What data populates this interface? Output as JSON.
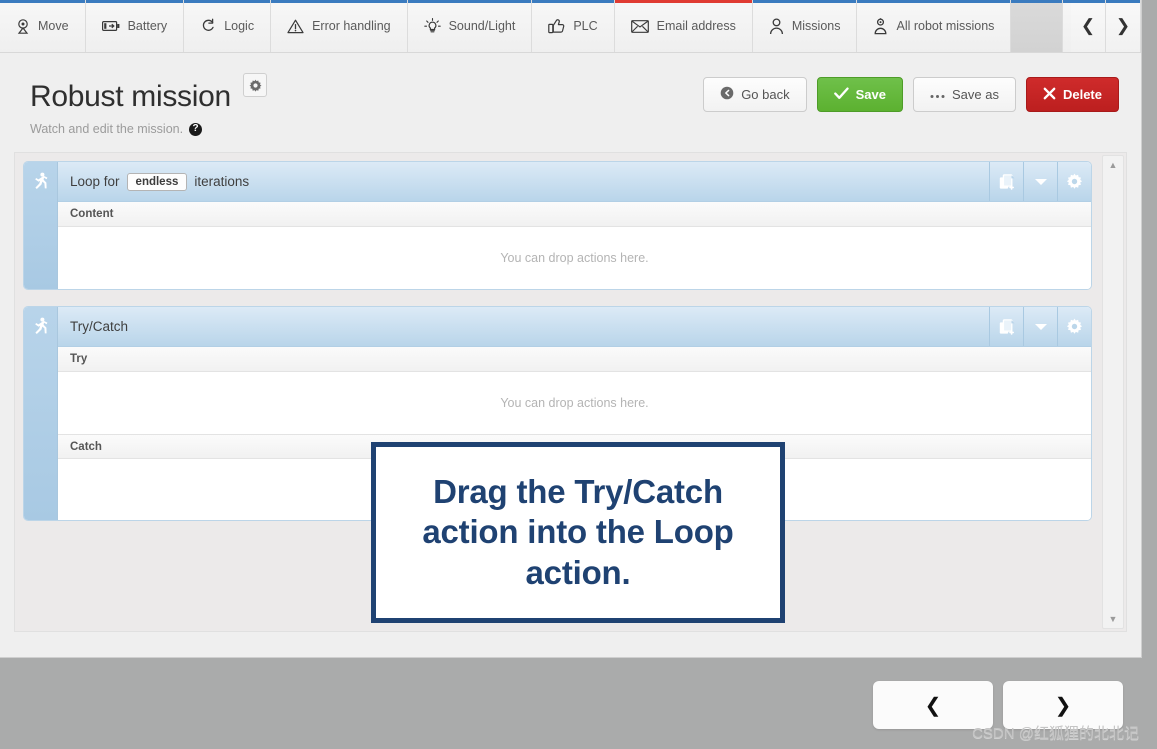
{
  "toolbar": {
    "tabs": [
      {
        "label": "Move",
        "icon": "location-pin-icon",
        "accent": "#3a7bbf"
      },
      {
        "label": "Battery",
        "icon": "battery-icon",
        "accent": "#3a7bbf"
      },
      {
        "label": "Logic",
        "icon": "loop-arrow-icon",
        "accent": "#3a7bbf"
      },
      {
        "label": "Error handling",
        "icon": "warning-triangle-icon",
        "accent": "#3a7bbf"
      },
      {
        "label": "Sound/Light",
        "icon": "lightbulb-icon",
        "accent": "#3a7bbf"
      },
      {
        "label": "PLC",
        "icon": "thumbs-up-icon",
        "accent": "#3a7bbf"
      },
      {
        "label": "Email address",
        "icon": "envelope-icon",
        "accent": "#e03b32"
      },
      {
        "label": "Missions",
        "icon": "person-icon",
        "accent": "#3a7bbf"
      },
      {
        "label": "All robot missions",
        "icon": "robot-person-icon",
        "accent": "#3a7bbf"
      }
    ],
    "prev_label": "❮",
    "next_label": "❯"
  },
  "header": {
    "title": "Robust mission",
    "subtitle": "Watch and edit the mission.",
    "help_glyph": "?",
    "settings_icon": "gear-icon",
    "actions": {
      "go_back": "Go back",
      "save": "Save",
      "save_as": "Save as",
      "delete": "Delete"
    }
  },
  "cards": [
    {
      "handle_icon": "running-person-icon",
      "title_prefix": "Loop for",
      "pill": "endless",
      "title_suffix": "iterations",
      "tools": [
        "duplicate-icon",
        "chevron-down-icon",
        "gear-icon"
      ],
      "sections": [
        {
          "label": "Content",
          "placeholder": "You can drop actions here."
        }
      ]
    },
    {
      "handle_icon": "running-person-icon",
      "title_prefix": "Try/Catch",
      "pill": "",
      "title_suffix": "",
      "tools": [
        "duplicate-icon",
        "chevron-down-icon",
        "gear-icon"
      ],
      "sections": [
        {
          "label": "Try",
          "placeholder": "You can drop actions here."
        },
        {
          "label": "Catch",
          "placeholder": ""
        }
      ]
    }
  ],
  "callout": {
    "text": "Drag the Try/Catch action into the Loop action."
  },
  "pager": {
    "prev": "❮",
    "next": "❯"
  },
  "watermark": "CSDN @红狐狸的北北记",
  "colors": {
    "accent_blue": "#3a7bbf",
    "accent_red": "#e03b32",
    "save_green": "#5cb130",
    "delete_red": "#bc1f1f",
    "callout_navy": "#1f4272",
    "card_blue": "#b9d5ea",
    "page_gray": "#aaabab"
  }
}
